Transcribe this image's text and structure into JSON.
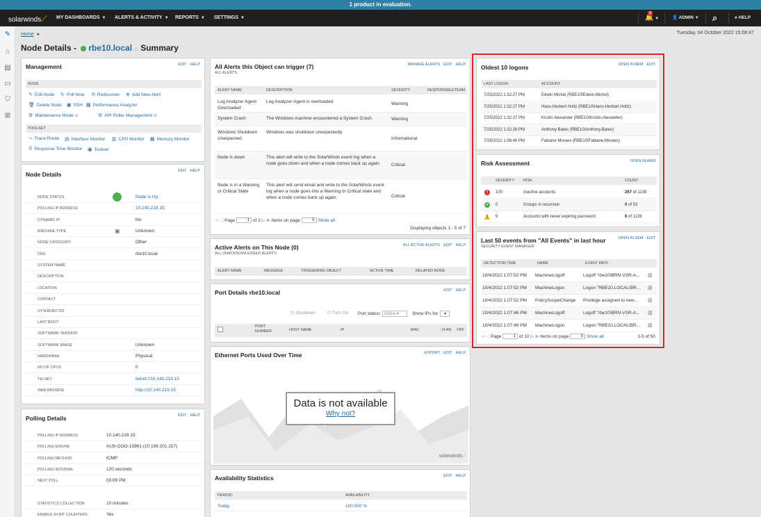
{
  "banner": "1 product in evaluation.",
  "topnav": {
    "logo": "solarwinds",
    "items": [
      "MY DASHBOARDS",
      "ALERTS & ACTIVITY",
      "REPORTS",
      "SETTINGS"
    ],
    "alert_count": "3",
    "admin": "ADMIN",
    "help": "HELP"
  },
  "breadcrumb": "Home",
  "date": "Tuesday, 04 October 2022 15:08:47",
  "title": {
    "prefix": "Node Details -",
    "node": "rbe10.local",
    "suffix": "Summary"
  },
  "management": {
    "title": "Management",
    "actions": [
      "EDIT",
      "HELP"
    ],
    "node_header": "NODE",
    "node_links": [
      "Edit Node",
      "Poll Now",
      "Rediscover",
      "Add New Alert",
      "Delete Node",
      "SSH",
      "Performance Analyzer",
      "Maintenance Mode",
      "API Poller Management"
    ],
    "toolset_header": "TOOLSET",
    "toolset_links": [
      "Trace Route",
      "Interface Monitor",
      "CPU Monitor",
      "Memory Monitor",
      "Response Time Monitor",
      "Toolset"
    ]
  },
  "node_details": {
    "title": "Node Details",
    "actions": [
      "EDIT",
      "HELP"
    ],
    "rows": [
      {
        "label": "NODE STATUS",
        "value": "Node is Up."
      },
      {
        "label": "POLLING IP ADDRESS",
        "value": "10.140.219.15"
      },
      {
        "label": "DYNAMIC IP",
        "value": "No"
      },
      {
        "label": "MACHINE TYPE",
        "value": "Unknown"
      },
      {
        "label": "NODE CATEGORY",
        "value": "Other"
      },
      {
        "label": "DNS",
        "value": "rbe10.local"
      },
      {
        "label": "SYSTEM NAME",
        "value": ""
      },
      {
        "label": "DESCRIPTION",
        "value": ""
      },
      {
        "label": "LOCATION",
        "value": ""
      },
      {
        "label": "CONTACT",
        "value": ""
      },
      {
        "label": "SYSOBJECTID",
        "value": ""
      },
      {
        "label": "LAST BOOT",
        "value": ""
      },
      {
        "label": "SOFTWARE VERSION",
        "value": ""
      },
      {
        "label": "SOFTWARE IMAGE",
        "value": "Unknown"
      },
      {
        "label": "HARDWARE",
        "value": "Physical"
      },
      {
        "label": "NO OF CPUS",
        "value": "0"
      },
      {
        "label": "TELNET",
        "value": "telnet://10.140.219.15"
      },
      {
        "label": "WEB BROWSE",
        "value": "http://10.140.219.15"
      }
    ]
  },
  "polling": {
    "title": "Polling Details",
    "actions": [
      "EDIT",
      "HELP"
    ],
    "rows": [
      {
        "label": "POLLING IP ADDRESS",
        "value": "10.140.219.15"
      },
      {
        "label": "POLLING ENGINE",
        "value": "AUS-OOO-15961 (10.199.201.157)"
      },
      {
        "label": "POLLING METHOD:",
        "value": "ICMP"
      },
      {
        "label": "POLLING INTERVAL",
        "value": "120 seconds"
      },
      {
        "label": "NEXT POLL",
        "value": "03:09 PM"
      },
      {
        "label": "STATISTICS COLLECTION",
        "value": "10 minutes"
      },
      {
        "label": "ENABLE 64 BIT COUNTERS",
        "value": "Yes"
      }
    ]
  },
  "alerts": {
    "title": "All Alerts this Object can trigger (7)",
    "subtitle": "ALL ALERTS",
    "actions": [
      "MANAGE ALERTS",
      "EDIT",
      "HELP"
    ],
    "columns": [
      "ALERT NAME",
      "DESCRIPTION",
      "SEVERITY",
      "RESPONSIBLETEAM"
    ],
    "rows": [
      {
        "name": "Log Analyzer Agent Overloaded",
        "desc": "Log Analyzer Agent is overloaded",
        "sev": "Warning"
      },
      {
        "name": "System Crash",
        "desc": "The Windows machine encountered a System Crash.",
        "sev": "Warning"
      },
      {
        "name": "Windows Shutdown Unexpected",
        "desc": "Windows was shutdown unexpectedly",
        "sev": "Informational"
      },
      {
        "name": "Node is down",
        "desc": "This alert will write to the SolarWinds event log when a node goes down and when a node comes back up again.",
        "sev": "Critical"
      },
      {
        "name": "Node is in a Warning or Critical State",
        "desc": "This alert will send email and write to the SolarWinds event log when a node goes into a Warning or Critical state and when a node comes back up again.",
        "sev": "Critical"
      }
    ],
    "pager": {
      "page_label": "Page",
      "page": "1",
      "of": "of 2",
      "items_label": "Items on page",
      "items": "5",
      "show_all": "Show all"
    },
    "displaying": "Displaying objects 1 - 5 of 7"
  },
  "active_alerts": {
    "title": "Active Alerts on This Node (0)",
    "subtitle": "ALL UNACKNOWLEDGED ALERTS",
    "actions": [
      "ALL ACTIVE ALERTS",
      "EDIT",
      "HELP"
    ],
    "columns": [
      "ALERT NAME",
      "MESSAGE",
      "TRIGGERING OBJECT",
      "ACTIVE TIME",
      "RELATED NODE"
    ]
  },
  "port_details": {
    "title": "Port Details rbe10.local",
    "actions": [
      "EDIT",
      "HELP"
    ],
    "shutdown": "Shutdown",
    "turnon": "Turn On",
    "port_status_label": "Port status:",
    "port_status_value": "Active",
    "show_ips_label": "Show IPs for:",
    "columns": [
      "PORT NUMBER",
      "HOST NAME",
      "IP",
      "MAC",
      "VLAN",
      "VRF"
    ]
  },
  "ethernet": {
    "title": "Ethernet Ports Used Over Time",
    "actions": [
      "EXPORT",
      "EDIT",
      "HELP"
    ],
    "no_data": "Data is not available",
    "why": "Why not?",
    "watermark": "solarwinds"
  },
  "availability": {
    "title": "Availability Statistics",
    "actions": [
      "EDIT",
      "HELP"
    ],
    "columns": [
      "PERIOD",
      "AVAILABILITY"
    ],
    "rows": [
      {
        "period": "Today",
        "value": "100.000 %"
      }
    ]
  },
  "logons": {
    "title": "Oldest 10 logons",
    "actions": [
      "OPEN IN ARM",
      "EDIT"
    ],
    "columns": [
      "LAST LOGON",
      "ACCOUNT"
    ],
    "rows": [
      {
        "time": "7/25/2022 1:32:27 PM",
        "account": "Edwin Michel (RBE10\\Edwin.Michel)"
      },
      {
        "time": "7/25/2022 1:32:27 PM",
        "account": "Hans-Herbert Holtz (RBE10\\Hans-Herbert.Holtz)"
      },
      {
        "time": "7/25/2022 1:32:27 PM",
        "account": "Kristin Alexander (RBE10\\Kristin.Alexander)"
      },
      {
        "time": "7/25/2022 1:32:28 PM",
        "account": "Anthony Bates (RBE10\\Anthony.Bates)"
      },
      {
        "time": "7/25/2022 1:36:40 PM",
        "account": "Fabiane Moraes (RBE10\\Fabiane.Moraes)"
      }
    ]
  },
  "risk": {
    "title": "Risk Assessment",
    "actions": [
      "OPEN IN ARM"
    ],
    "columns": [
      "SEVERITY",
      "RISK",
      "COUNT"
    ],
    "rows": [
      {
        "sev": "100",
        "risk": "Inactive accounts",
        "count": "267",
        "total": "of 1139",
        "icon": "error-icon",
        "color": "#d9342b"
      },
      {
        "sev": "0",
        "risk": "Groups in recursion",
        "count": "0",
        "total": "of 53",
        "icon": "ok-icon",
        "color": "#4caf50"
      },
      {
        "sev": "9",
        "risk": "Accounts with never expiring password",
        "count": "8",
        "total": "of 1139",
        "icon": "warning-icon",
        "color": "#f5b800"
      }
    ]
  },
  "events": {
    "title": "Last 50 events from \"All Events\" in last hour",
    "subtitle": "SECURITY EVENT MANAGER",
    "actions": [
      "OPEN IN SEM",
      "EDIT"
    ],
    "columns": [
      "DETECTION TIME",
      "NAME",
      "EVENT INFO"
    ],
    "rows": [
      {
        "time": "10/4/2022 1:07:52 PM",
        "name": "MachineLogoff",
        "info": "Logoff \"rbe10\\BRN-VSR-A..."
      },
      {
        "time": "10/4/2022 1:07:52 PM",
        "name": "MachineLogon",
        "info": "Logon \"RBE10.LOCAL\\BR..."
      },
      {
        "time": "10/4/2022 1:07:52 PM",
        "name": "PolicyScopeChange",
        "info": "Privilege assigned to new..."
      },
      {
        "time": "10/4/2022 1:07:46 PM",
        "name": "MachineLogoff",
        "info": "Logoff \"rbe10\\BRN-VSR-A..."
      },
      {
        "time": "10/4/2022 1:07:46 PM",
        "name": "MachineLogon",
        "info": "Logon \"RBE10.LOCAL\\BR..."
      }
    ],
    "pager": {
      "page_label": "Page",
      "page": "1",
      "of": "of 10",
      "items_label": "Items on page",
      "items": "5",
      "show_all": "Show all",
      "range": "1-5 of 50"
    }
  }
}
